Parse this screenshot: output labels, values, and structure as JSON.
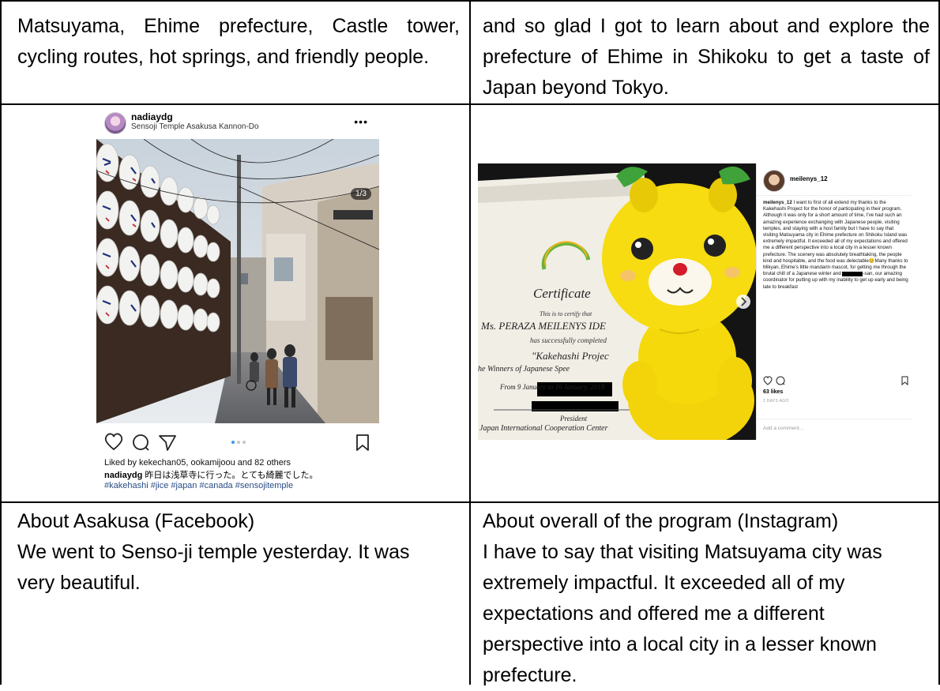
{
  "table": {
    "row1": {
      "left": "Matsuyama, Ehime prefecture, Castle tower, cycling routes, hot springs, and friendly people.",
      "right": "and so glad I got to learn about and explore the prefecture of Ehime in Shikoku to get a taste of Japan beyond Tokyo."
    },
    "row3": {
      "left_title": "About Asakusa (Facebook)",
      "left_body": "We went to Senso-ji temple yesterday. It was very beautiful.",
      "right_title": "About overall of the program (Instagram)",
      "right_body": "I have to say that visiting Matsuyama city was extremely impactful. It exceeded all of my expectations and offered me a different perspective into a local city in a lesser known prefecture."
    }
  },
  "post1": {
    "username": "nadiaydg",
    "location": "Sensoji Temple Asakusa Kannon-Do",
    "more": "•••",
    "pager": "1/3",
    "likes": "Liked by kekechan05, ookamijoou and 82 others",
    "caption_user": "nadiaydg",
    "caption_text": " 昨日は浅草寺に行った。とても綺麗でした。",
    "hashtags": "#kakehashi #jice #japan #canada #sensojitemple"
  },
  "post2": {
    "username": "meilenys_12",
    "caption_user": "meilenys_12",
    "caption_a": " I want to first of all extend my thanks to the Kakehashi Project for the honor of participating in their program. Although it was only for a short amount of time, I've had such an amazing experience exchanging with Japanese people, visiting temples, and staying with a host family but I have to say that visiting Matsuyama city in Ehime prefecture on Shikoku Island was extremely impactful. It exceeded all of my expectations and offered me a different perspective into a local city in a lesser known prefecture. The scenery was absolutely breathtaking, the people kind and hospitable, and the food was delectable😊Many thanks to Mikyan, Ehime's little mandarin mascot, for getting me through the brutal chill of a Japanese winter and ",
    "caption_b": "-san, our amazing coordinator for putting up with my inability to get up early and being late to breakfast",
    "likes": "63 likes",
    "ago": "2 DAYS AGO",
    "add_comment": "Add a comment...",
    "certificate": {
      "title": "Certificate",
      "line1": "This is to certify that",
      "name": "Ms. PERAZA MEILENYS IDE",
      "line2": "has successfully completed",
      "program": "\"Kakehashi Projec",
      "winners": "he Winners of Japanese Spee",
      "dates": "From 9 January to 16 January, 2018",
      "president": "President",
      "org": "Japan International Cooperation Center"
    }
  },
  "colors": {
    "border": "#000000",
    "hashtag": "#2a4d86",
    "mascot": "#f5d90a"
  }
}
